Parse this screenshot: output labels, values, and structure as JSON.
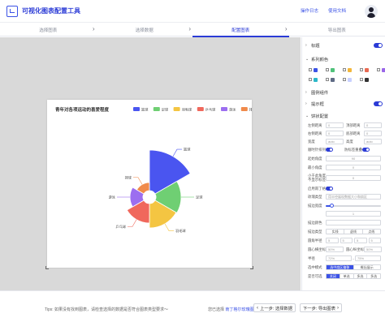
{
  "header": {
    "title": "可视化图表配置工具",
    "links": [
      "操作日志",
      "使用文档"
    ]
  },
  "steps": [
    {
      "label": "选择图表",
      "active": false
    },
    {
      "label": "选择数据",
      "active": false
    },
    {
      "label": "配置图表",
      "active": true
    },
    {
      "label": "导出图表",
      "active": false
    }
  ],
  "chart_data": {
    "type": "nightingale-rose",
    "title": "青年对各项运动的喜爱程度",
    "categories": [
      "篮球",
      "足球",
      "羽毛球",
      "乒乓球",
      "游泳",
      "排球"
    ],
    "colors": [
      "#4a55f0",
      "#6fcf73",
      "#f4c542",
      "#f0685c",
      "#9c6ef0",
      "#f08a4b"
    ],
    "values": [
      100,
      62,
      60,
      48,
      32,
      20
    ]
  },
  "panel": {
    "sections": {
      "title": "标题",
      "series_colors": "系列颜色",
      "legend": "图例组件",
      "tooltip": "提示框",
      "pie_config": "饼状配置"
    },
    "swatch_colors": [
      "#3b52e6",
      "#4fc27a",
      "#f2b63b",
      "#e86a52",
      "#9a66e8",
      "#2bb8c9",
      "#5f6b85",
      "#c8d0ff",
      "#333333"
    ],
    "form": {
      "left_margin": "左侧距离",
      "left_margin_val": "0",
      "top_margin": "顶部距离",
      "top_margin_val": "0",
      "right_margin": "右侧距离",
      "right_margin_val": "0",
      "bottom_margin": "底部距离",
      "bottom_margin_val": "0",
      "width": "宽度",
      "width_val": "auto",
      "height": "高度",
      "height_val": "auto",
      "clockwise": "顺时针排列",
      "label_overlap": "防标签重叠",
      "start_angle": "起始角度",
      "start_angle_val": "90",
      "min_angle": "最小角度",
      "min_angle_val": "0",
      "min_sector_label": "小于此角度不显示标签",
      "min_sector_val": "0",
      "rose_type": "启用南丁格尔",
      "rose_sub_label": "玫瑰类型",
      "rose_sub_val": "用半径展现数据大小和扇区",
      "stroke_width": "描边宽度",
      "stroke_width_val": "1",
      "stroke_color": "描边颜色",
      "stroke_type": "描边类型",
      "stroke_types": [
        "实线",
        "虚线",
        "点线"
      ],
      "radius_inner": "圆角半径",
      "radius_vals": [
        "5",
        "5",
        "5",
        "5"
      ],
      "center_x": "圆心横坐标",
      "center_x_val": "50%",
      "center_y": "圆心纵坐标",
      "center_y_val": "50%",
      "radius": "半径",
      "radius_a": "72%",
      "radius_b": "75%",
      "selected_mode": "选中模式",
      "selected_modes": [
        "选中扇区偏移",
        "概括展示"
      ],
      "selected_type": "是否可选",
      "selected_types": [
        "关闭",
        "单选",
        "多选",
        "多选"
      ]
    }
  },
  "footer": {
    "tip": "Tips: 如果没有找到图表，请检查选择的数据是否符合图表类型要求～",
    "preview_prefix": "您已选择",
    "preview_link": "南丁格尔玫瑰图",
    "prev_button": "上一步: 选择数据",
    "next_button": "下一步: 导出图表"
  }
}
